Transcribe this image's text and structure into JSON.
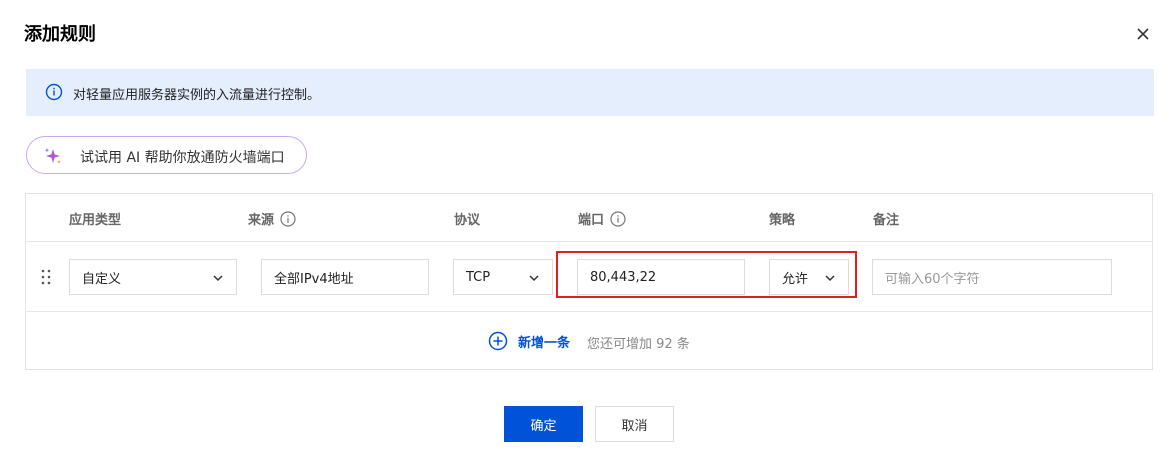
{
  "dialog": {
    "title": "添加规则",
    "close_icon": "close-icon"
  },
  "banner": {
    "icon": "info-icon",
    "text": "对轻量应用服务器实例的入流量进行控制。"
  },
  "ai_button": {
    "icon": "sparkle-icon",
    "label": "试试用 AI 帮助你放通防火墙端口"
  },
  "table": {
    "headers": {
      "app_type": "应用类型",
      "source": "来源",
      "protocol": "协议",
      "port": "端口",
      "policy": "策略",
      "remark": "备注"
    },
    "row": {
      "app_type": "自定义",
      "source": "全部IPv4地址",
      "protocol": "TCP",
      "port": "80,443,22",
      "policy": "允许",
      "remark_placeholder": "可输入60个字符"
    },
    "add_label": "新增一条",
    "add_hint": "您还可增加 92 条"
  },
  "footer": {
    "ok_label": "确定",
    "cancel_label": "取消"
  },
  "colors": {
    "primary": "#0052d9",
    "banner_bg": "#e5eefd",
    "highlight": "#e02020"
  }
}
